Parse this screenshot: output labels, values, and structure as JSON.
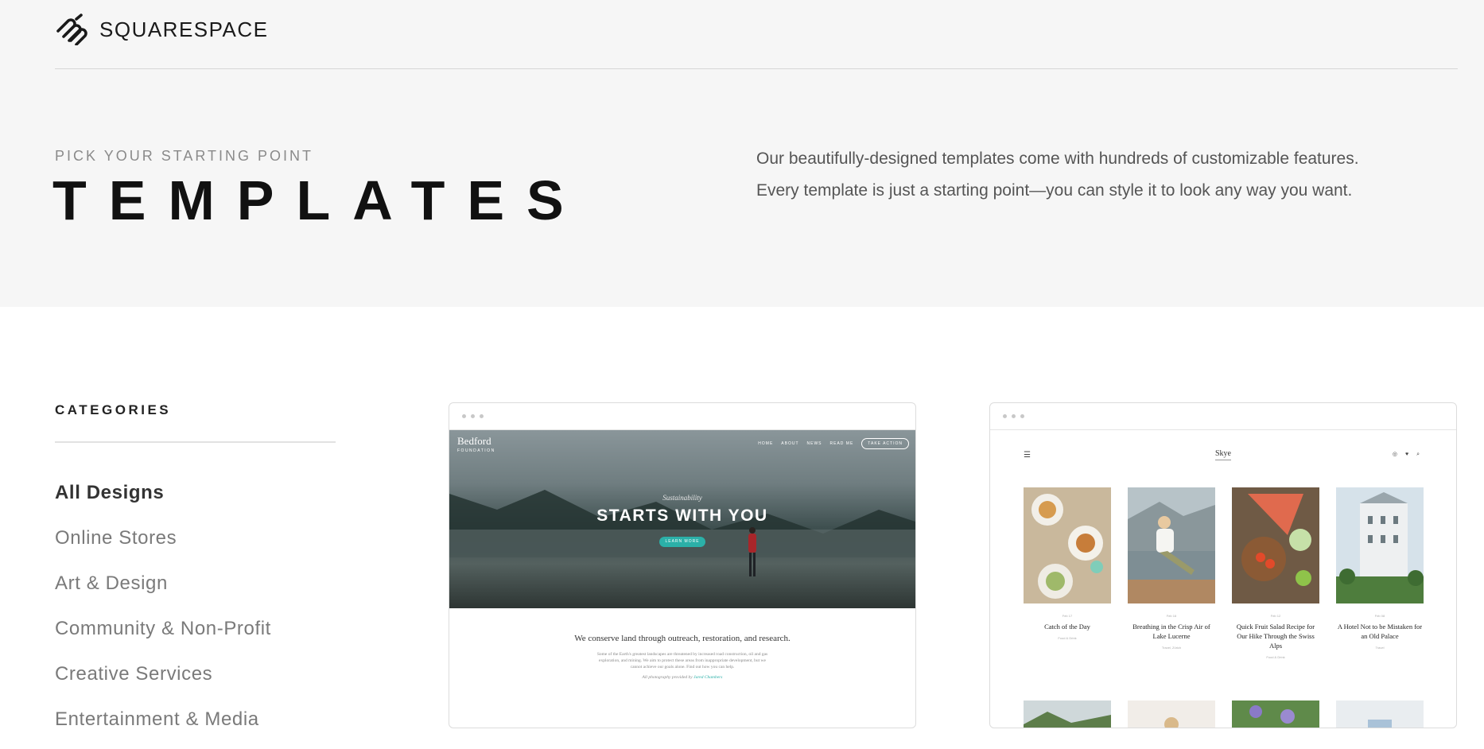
{
  "brand": {
    "name": "SQUARESPACE"
  },
  "hero": {
    "eyebrow": "PICK YOUR STARTING POINT",
    "title": "TEMPLATES",
    "description": "Our beautifully-designed templates come with hundreds of customizable features. Every template is just a starting point—you can style it to look any way you want."
  },
  "categories": {
    "heading": "CATEGORIES",
    "items": [
      {
        "label": "All Designs",
        "active": true
      },
      {
        "label": "Online Stores"
      },
      {
        "label": "Art & Design"
      },
      {
        "label": "Community & Non-Profit"
      },
      {
        "label": "Creative Services"
      },
      {
        "label": "Entertainment & Media"
      }
    ]
  },
  "templates": {
    "bedford": {
      "logo": "Bedford",
      "logo_sub": "FOUNDATION",
      "nav": [
        "HOME",
        "ABOUT",
        "NEWS",
        "READ ME"
      ],
      "cta": "TAKE ACTION",
      "eyebrow": "Sustainability",
      "title": "STARTS WITH YOU",
      "button": "LEARN MORE",
      "body_title": "We conserve land through outreach, restoration, and research.",
      "body_text": "Some of the Earth's greatest landscapes are threatened by increased road construction, oil and gas exploration, and mining. We aim to protect these areas from inappropriate development, but we cannot achieve our goals alone. Find out how you can help.",
      "credit_prefix": "All photography provided by",
      "credit_name": "Jared Chambers"
    },
    "skye": {
      "logo": "Skye",
      "menu_icon": "☰",
      "social_icons": "◎ ♥",
      "search_icon": "⌕",
      "posts": [
        {
          "date": "Feb 17",
          "title": "Catch of the Day",
          "tag": "Food & Drink"
        },
        {
          "date": "Feb 16",
          "title": "Breathing in the Crisp Air of Lake Lucerne",
          "tag": "Travel, Zürich"
        },
        {
          "date": "Feb 12",
          "title": "Quick Fruit Salad Recipe for Our Hike Through the Swiss Alps",
          "tag": "Food & Drink"
        },
        {
          "date": "Feb 08",
          "title": "A Hotel Not to be Mistaken for an Old Palace",
          "tag": "Travel"
        }
      ]
    }
  },
  "colors": {
    "accent_teal": "#2bb0a8",
    "band_bg": "#f6f6f6"
  }
}
